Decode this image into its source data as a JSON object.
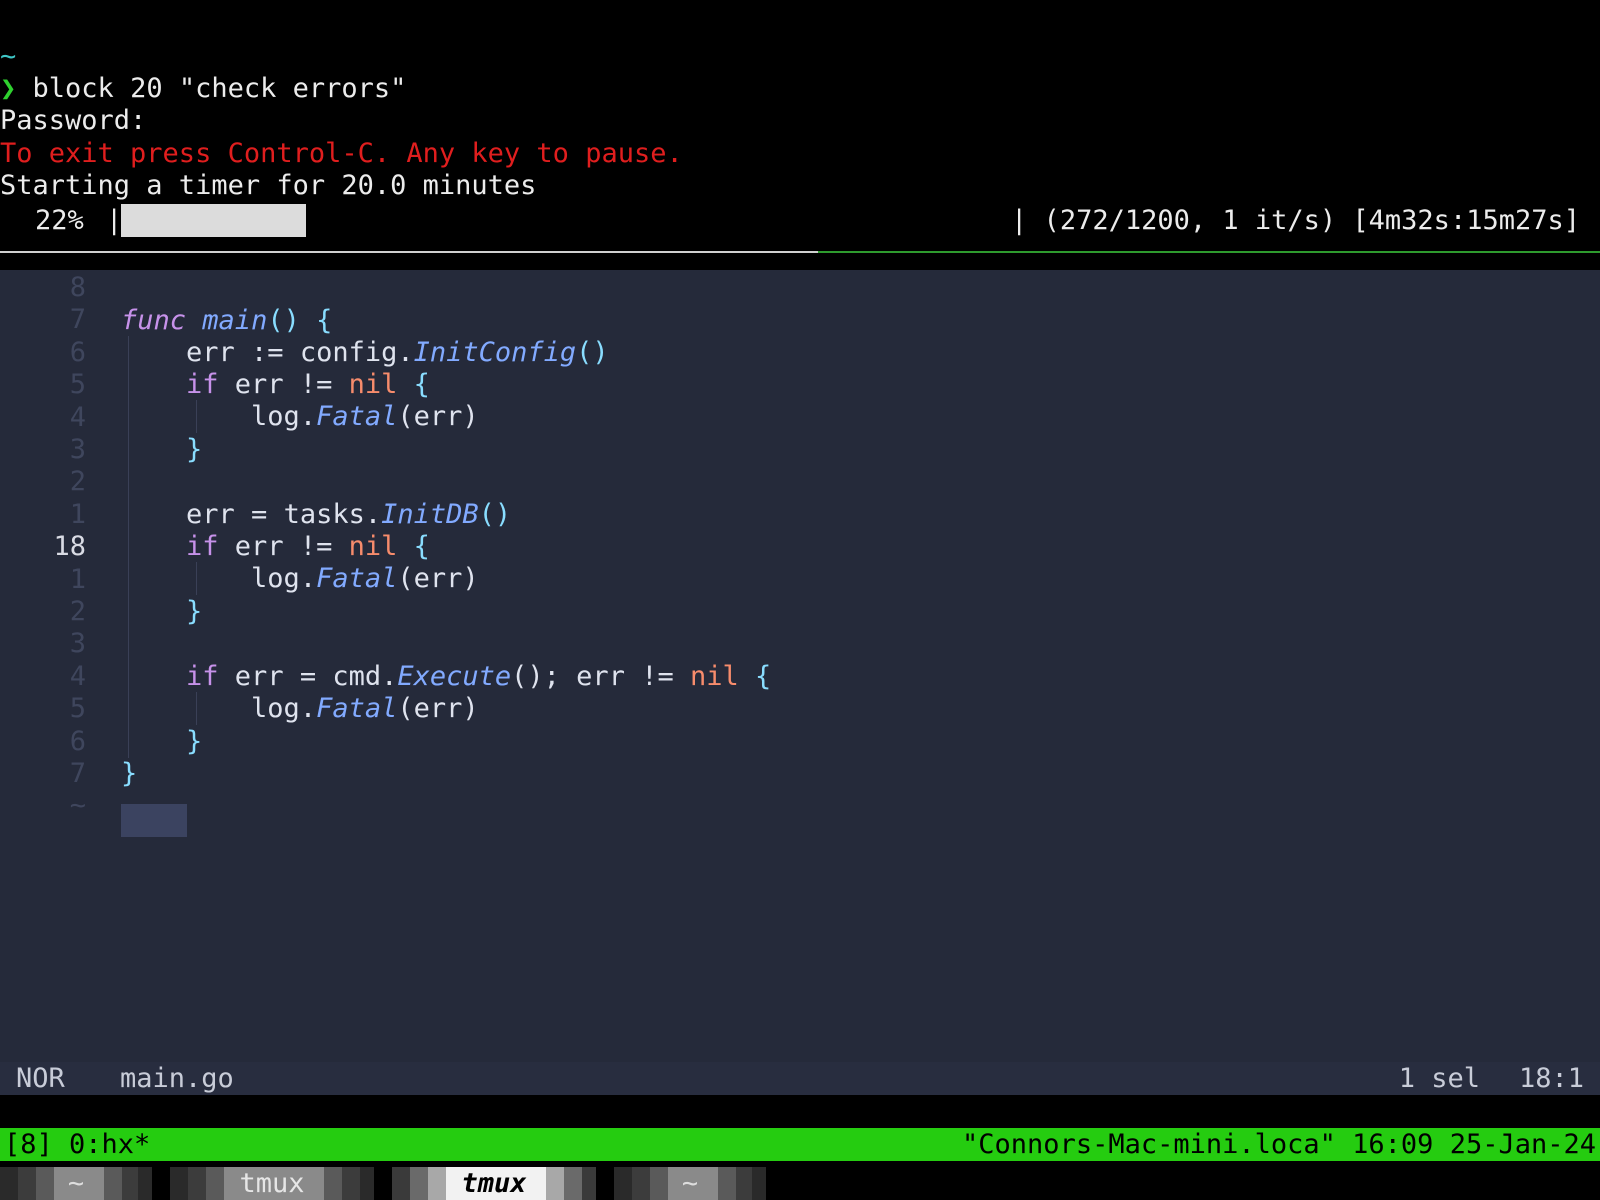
{
  "terminal": {
    "cwd": "~",
    "prompt_symbol": "❯",
    "command": "block 20 \"check errors\"",
    "password_prompt": "Password:",
    "exit_hint": "To exit press Control-C. Any key to pause.",
    "timer_message": "Starting a timer for 20.0 minutes",
    "progress_percent_text": "22%",
    "progress_fraction": 0.2267,
    "progress_stats": "| (272/1200, 1 it/s) [4m32s:15m27s]"
  },
  "editor": {
    "gutter": [
      "8",
      "7",
      "6",
      "5",
      "4",
      "3",
      "2",
      "1",
      "18",
      "1",
      "2",
      "3",
      "4",
      "5",
      "6",
      "7",
      "~"
    ],
    "current_line_number": "18",
    "code": {
      "l_func": "func",
      "l_main": "main",
      "l_paren_open": "() {",
      "config_pre": "err := config.",
      "config_fn": "InitConfig",
      "paren": "()",
      "if": "if",
      "err_ne": " err != ",
      "nil": "nil",
      "brace_open": " {",
      "log": "log.",
      "fatal": "Fatal",
      "err_arg": "(err)",
      "brace_close": "}",
      "tasks_pre": "err = tasks.",
      "tasks_fn": "InitDB",
      "cmd_pre": " err = cmd.",
      "cmd_fn": "Execute",
      "cmd_post": "(); err != "
    }
  },
  "statusline": {
    "mode": "NOR",
    "filename": "main.go",
    "selections": "1 sel",
    "cursor": "18:1"
  },
  "tmux": {
    "session_window": "[8] 0:hx*",
    "host_time": "\"Connors-Mac-mini.loca\" 16:09 25-Jan-24",
    "bar_color": "#25cc10"
  },
  "tabs": [
    {
      "label": "~",
      "active": false
    },
    {
      "label": "tmux",
      "active": false
    },
    {
      "label": "tmux",
      "active": true
    },
    {
      "label": "~",
      "active": false
    }
  ]
}
